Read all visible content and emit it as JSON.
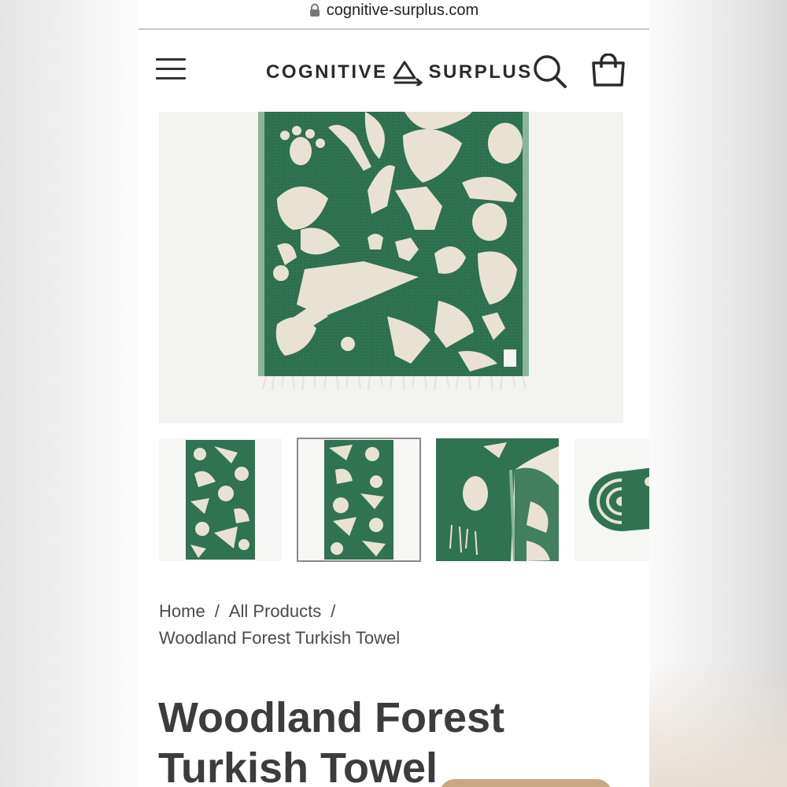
{
  "browser": {
    "url": "cognitive-surplus.com",
    "lock_icon": "lock-icon"
  },
  "header": {
    "menu_icon": "hamburger-menu-icon",
    "logo_left": "COGNITIVE",
    "logo_right": "SURPLUS",
    "logo_symbol": "delta-arrow-logo-icon",
    "search_icon": "search-icon",
    "cart_icon": "shopping-bag-icon"
  },
  "gallery": {
    "hero_alt": "Woodland Forest Turkish Towel",
    "towel_color": "#2f7352",
    "pattern_color": "#e9e2d4",
    "thumbnails": [
      "towel-full-view",
      "towel-full-view-selected",
      "towel-corner-closeup",
      "towel-rolled"
    ],
    "selected_index": 1
  },
  "breadcrumb": {
    "home": "Home",
    "all_products": "All Products",
    "current": "Woodland Forest Turkish Towel",
    "separator": "/"
  },
  "product": {
    "title_line1": "Woodland Forest",
    "title_line2": "Turkish Towel"
  }
}
